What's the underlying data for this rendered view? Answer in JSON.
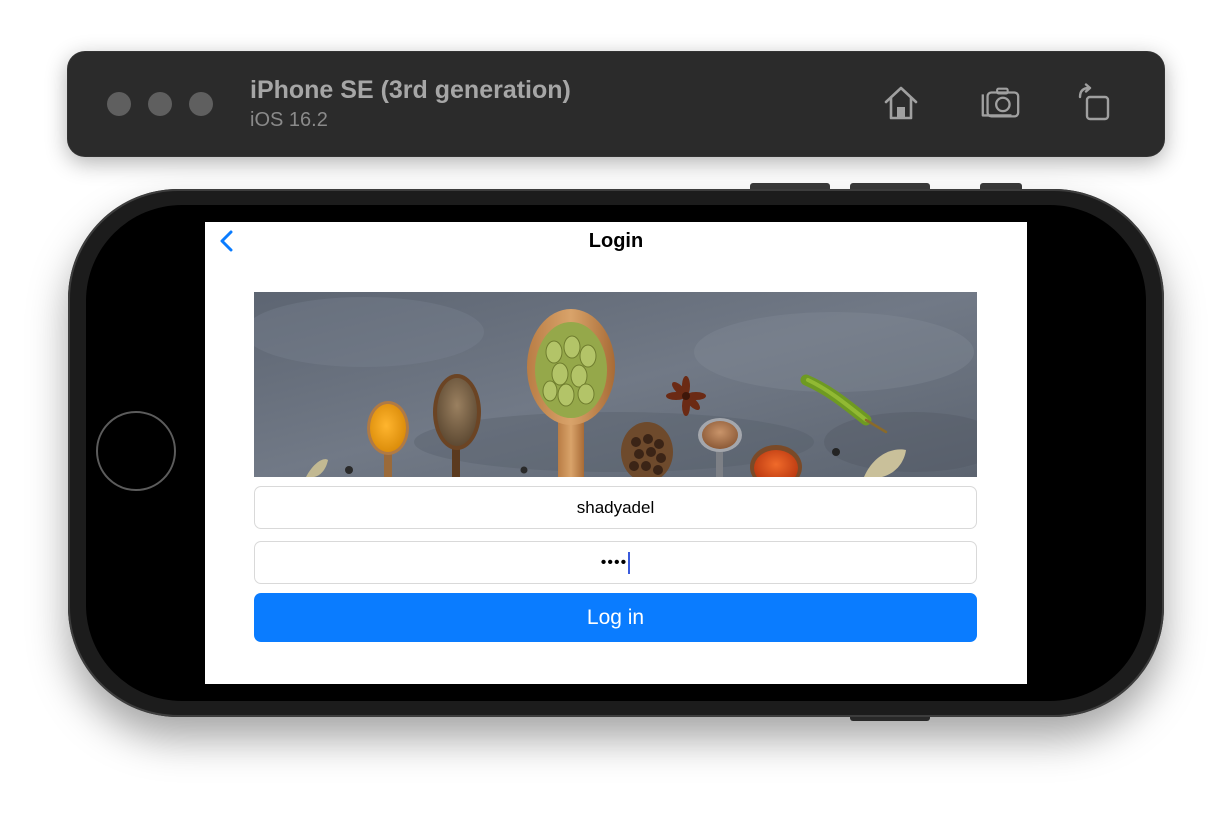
{
  "simulator": {
    "device_name": "iPhone SE (3rd generation)",
    "os_version": "iOS 16.2",
    "toolbar_icons": [
      "home-icon",
      "screenshot-icon",
      "rotate-icon"
    ],
    "traffic_lights": [
      "close",
      "minimize",
      "zoom"
    ]
  },
  "screen": {
    "nav": {
      "title": "Login",
      "back_icon": "chevron-left-icon"
    },
    "banner": {
      "description_icon": "spices-banner-image"
    },
    "username_field": {
      "value": "shadyadel"
    },
    "password_field": {
      "masked_value": "••••"
    },
    "login_button": {
      "label": "Log in"
    }
  },
  "colors": {
    "accent": "#0a7cff",
    "nav_back": "#0a7cff",
    "caret": "#3a5bdc"
  }
}
